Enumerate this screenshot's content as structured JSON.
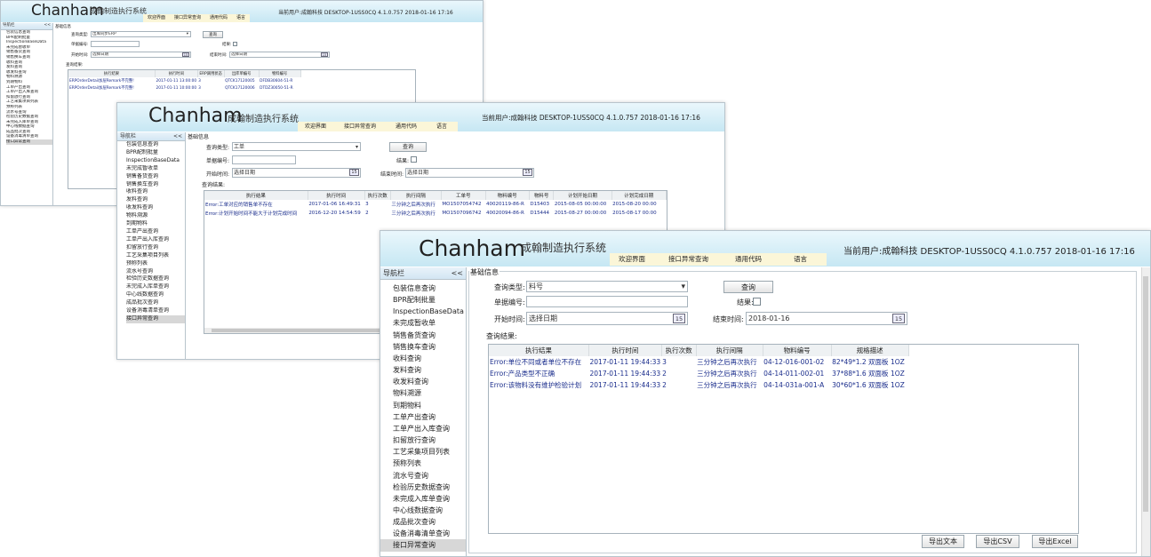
{
  "app": {
    "brand": "Chanham",
    "subtitle": "成翰制造执行系统",
    "tabs": [
      "欢迎界面",
      "接口异常查询",
      "通用代码",
      "语言"
    ]
  },
  "nav": {
    "title": "导航栏",
    "collapse": "<<",
    "items": [
      "包装信息查询",
      "BPR配制批量",
      "InspectionBaseData",
      "未完成暂收单",
      "销售备货查询",
      "销售换车查询",
      "收料查询",
      "发料查询",
      "收发料查询",
      "物料溯源",
      "到期物料",
      "工单产出查询",
      "工单产出入库查询",
      "扣留放行查询",
      "工艺采集项目列表",
      "预称列表",
      "流水号查询",
      "检验历史数据查询",
      "未完成入库单查询",
      "中心线数据查询",
      "成品批次查询",
      "设备消毒清单查询",
      "接口异常查询"
    ],
    "selected": "接口异常查询"
  },
  "form": {
    "section": "基础信息",
    "query_type_label": "查询类型:",
    "doc_no_label": "单据编号:",
    "start_label": "开始时间:",
    "end_label": "结束时间:",
    "result_flag_label": "结果:",
    "query_button": "查询",
    "results_label": "查询结果:",
    "date_placeholder": "选择日期",
    "cal_icon_text": "15"
  },
  "win1": {
    "user_info": "当前用户:成翰科技 DESKTOP-1USS0CQ  4.1.0.757  2018-01-16 17:16",
    "query_type": "出库同步ERP",
    "columns": [
      "执行结果",
      "执行时间",
      "ERP调用状态",
      "出库单编号",
      "物料编号"
    ],
    "rows": [
      [
        "ERPOrderDetail加层Remark不完整!",
        "2017-01-11 13:00:00",
        "3",
        "QTCK17120005",
        "DFDB30604-51-R"
      ],
      [
        "ERPOrderDetail加层Remark不完整!",
        "2017-01-11 10:00:00",
        "3",
        "QTCK17120006",
        "DTDZ30050-51-R"
      ]
    ]
  },
  "win2": {
    "user_info": "当前用户:成翰科技 DESKTOP-1USS0CQ  4.1.0.757  2018-01-16 17:16",
    "query_type": "工单",
    "columns": [
      "执行结果",
      "执行时间",
      "执行次数",
      "执行间隔",
      "工单号",
      "物料编号",
      "物料号",
      "计划开始日期",
      "计划完成日期"
    ],
    "rows": [
      [
        "Error:工单对应的销售单不存在",
        "2017-01-06 16:49:31",
        "3",
        "三分钟之后再次执行",
        "MO1507054742",
        "40020119-86-R",
        "D15403",
        "2015-08-05 00:00:00",
        "2015-08-20 00:00"
      ],
      [
        "Error:计划开始时间不能大于计划完成时间",
        "2016-12-20 14:54:59",
        "2",
        "三分钟之后再次执行",
        "MO1507096742",
        "40020094-86-R",
        "D15444",
        "2015-08-27 00:00:00",
        "2015-08-17 00:00"
      ]
    ]
  },
  "win3": {
    "user_info": "当前用户:成翰科技 DESKTOP-1USS0CQ  4.1.0.757  2018-01-16 17:16",
    "query_type": "料号",
    "end_value": "2018-01-16",
    "columns": [
      "执行结果",
      "执行时间",
      "执行次数",
      "执行间隔",
      "物料编号",
      "规格描述"
    ],
    "rows": [
      [
        "Error:单位不同或者单位不存在",
        "2017-01-11 19:44:33",
        "3",
        "三分钟之后再次执行",
        "04-12-016-001-02",
        "82*49*1.2 双面板 1OZ"
      ],
      [
        "Error:产品类型不正确",
        "2017-01-11 19:44:33",
        "2",
        "三分钟之后再次执行",
        "04-14-011-002-01",
        "37*88*1.6 双面板 1OZ"
      ],
      [
        "Error:该物料没有维护检验计划",
        "2017-01-11 19:44:33",
        "2",
        "三分钟之后再次执行",
        "04-14-031a-001-A",
        "30*60*1.6 双面板 1OZ"
      ]
    ],
    "export_text": "导出文本",
    "export_csv": "导出CSV",
    "export_excel": "导出Excel"
  }
}
